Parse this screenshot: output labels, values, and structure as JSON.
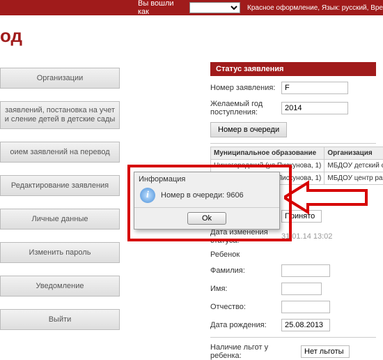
{
  "topbar": {
    "login_as": "Вы вошли как",
    "login_value": "",
    "theme": "Красное оформление, Язык: русский, Вре"
  },
  "page_title": "од",
  "sidebar": {
    "items": [
      "Организации",
      "заявлений, постановка на учет и сление детей в детские сады",
      "оием заявлений на перевод",
      "Редактирование заявления",
      "Личные данные",
      "Изменить пароль",
      "Уведомление",
      "Выйти"
    ]
  },
  "status": {
    "header": "Статус заявления",
    "app_no_label": "Номер заявления:",
    "app_no_value": "F",
    "year_label": "Желаемый год поступления:",
    "year_value": "2014",
    "queue_btn": "Номер в очереди",
    "table": {
      "col_mun": "Муниципальное образование",
      "col_org": "Организация",
      "rows": [
        {
          "mun": "Нижегородский (ул.Пискунова, 1)",
          "org": "МБДОУ детский сад комбинированного N"
        },
        {
          "mun": "Нижегородский (ул.Пискунова, 1)",
          "org": "МБДОУ центр развития ребенка-детски N"
        }
      ]
    },
    "accepted": "Принято",
    "date_change_label": "Дата изменения статуса:",
    "date_change_value": "31.01.14 13:02",
    "child_label": "Ребенок",
    "lastname_label": "Фамилия:",
    "lastname_value": "",
    "firstname_label": "Имя:",
    "firstname_value": "",
    "patronymic_label": "Отчество:",
    "patronymic_value": "",
    "birth_label": "Дата рождения:",
    "birth_value": "25.08.2013",
    "benefits_label": "Наличие льгот у ребенка:",
    "benefits_value": "Нет льготы"
  },
  "dialog": {
    "title": "Информация",
    "message": "Номер в очереди: 9606",
    "ok": "Ok"
  }
}
